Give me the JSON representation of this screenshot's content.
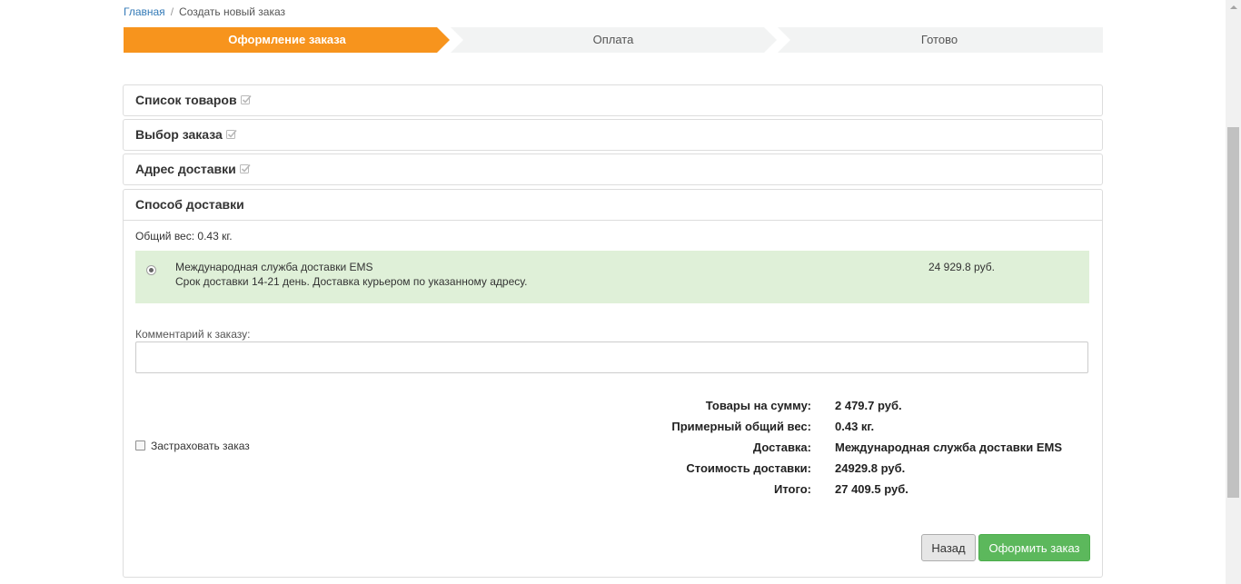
{
  "breadcrumb": {
    "home": "Главная",
    "separator": "/",
    "current": "Создать новый заказ"
  },
  "steps": [
    {
      "label": "Оформление заказа",
      "active": true
    },
    {
      "label": "Оплата",
      "active": false
    },
    {
      "label": "Готово",
      "active": false
    }
  ],
  "sections": {
    "goods": "Список товаров",
    "order_choice": "Выбор заказа",
    "address": "Адрес доставки",
    "delivery": "Способ доставки"
  },
  "delivery": {
    "total_weight": "Общий вес: 0.43 кг.",
    "option": {
      "name": "Международная служба доставки EMS",
      "description": "Срок доставки 14-21 день. Доставка курьером по указанному адресу.",
      "price": "24 929.8 руб.",
      "selected": true
    },
    "comment_label": "Комментарий к заказу:",
    "comment_value": "",
    "insure_label": "Застраховать заказ",
    "insure_checked": false
  },
  "summary": [
    {
      "key": "Товары на сумму:",
      "value": "2 479.7 руб."
    },
    {
      "key": "Примерный общий вес:",
      "value": "0.43 кг."
    },
    {
      "key": "Доставка:",
      "value": "Международная служба доставки EMS"
    },
    {
      "key": "Стоимость доставки:",
      "value": "24929.8 руб."
    },
    {
      "key": "Итого:",
      "value": "27 409.5 руб."
    }
  ],
  "buttons": {
    "back": "Назад",
    "submit": "Оформить заказ"
  },
  "colors": {
    "step_active": "#f7941d",
    "step_inactive": "#f2f3f3",
    "option_bg": "#dff0d8",
    "submit_bg": "#5cb85c",
    "link": "#337ab7"
  }
}
